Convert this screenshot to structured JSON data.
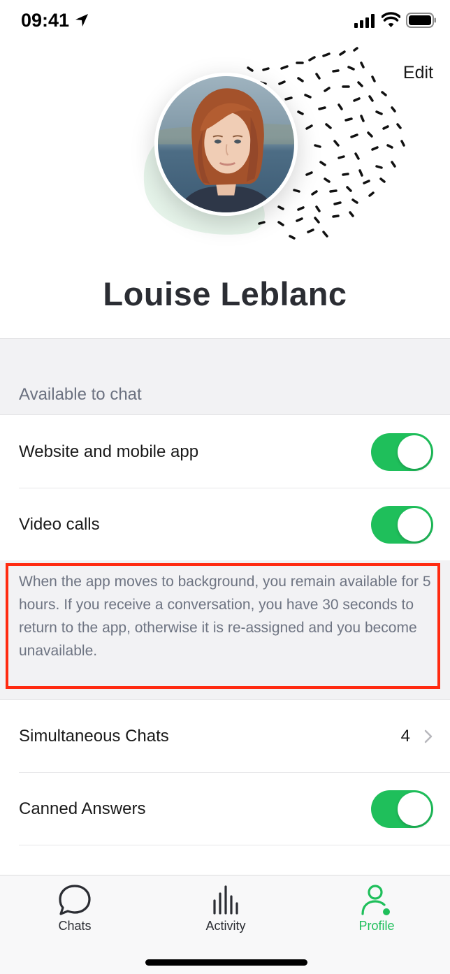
{
  "status_bar": {
    "time": "09:41",
    "icons": [
      "location-arrow-icon",
      "cellular-signal-icon",
      "wifi-icon",
      "battery-icon"
    ]
  },
  "header": {
    "edit_label": "Edit",
    "user_name": "Louise Leblanc"
  },
  "availability": {
    "section_label": "Available to chat",
    "rows": [
      {
        "label": "Website and mobile app",
        "enabled": true
      },
      {
        "label": "Video calls",
        "enabled": true
      }
    ],
    "note": "When the app moves to background, you remain available for 5 hours. If you receive a conversation, you have 30 seconds to return to the app, otherwise it is re-assigned and you become unavailable."
  },
  "settings": {
    "simultaneous_chats": {
      "label": "Simultaneous Chats",
      "value": "4"
    },
    "canned_answers": {
      "label": "Canned Answers",
      "enabled": true
    }
  },
  "tab_bar": {
    "tabs": [
      {
        "label": "Chats",
        "icon": "chat-bubble-icon",
        "active": false
      },
      {
        "label": "Activity",
        "icon": "activity-bars-icon",
        "active": false
      },
      {
        "label": "Profile",
        "icon": "profile-icon",
        "active": true
      }
    ]
  },
  "colors": {
    "accent_green": "#1fbf5b",
    "highlight_red": "#ff2a10",
    "name_text": "#2b2d33",
    "muted_text": "#6e7482"
  }
}
